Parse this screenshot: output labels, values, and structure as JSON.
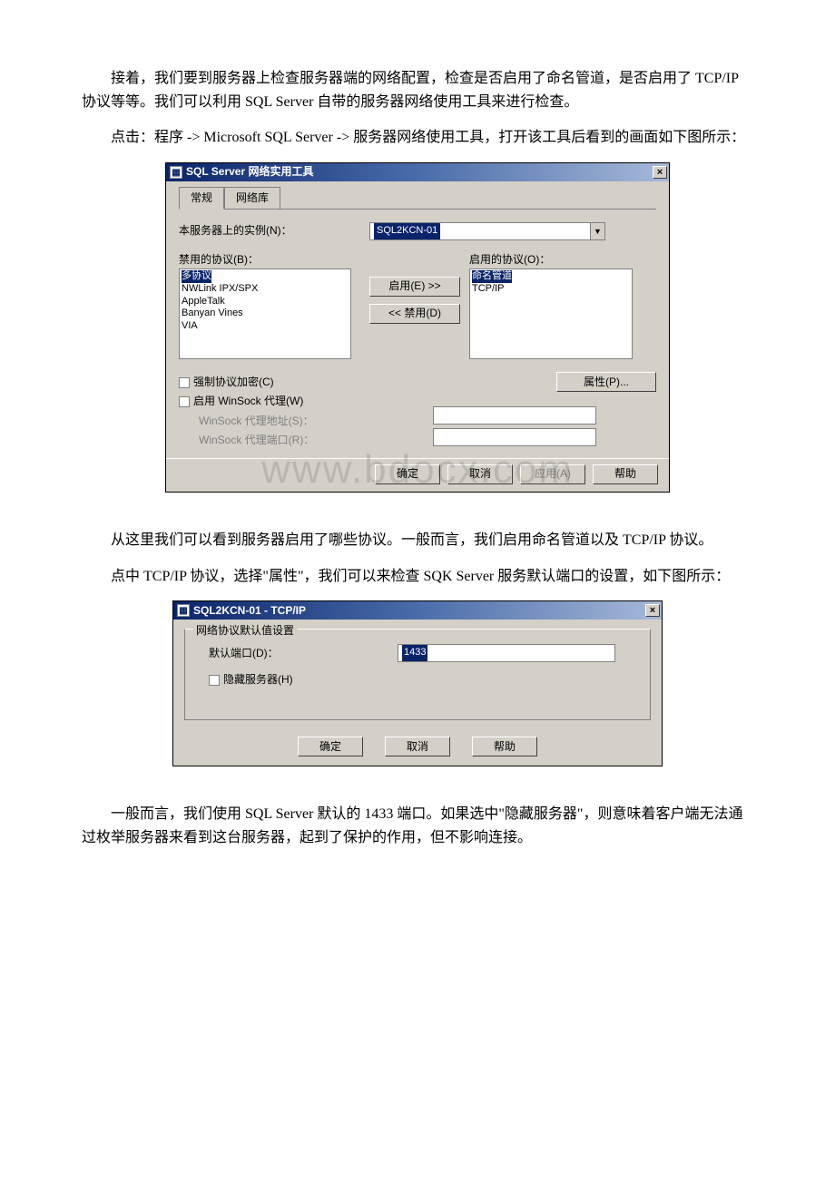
{
  "paragraphs": {
    "p1": "接着，我们要到服务器上检查服务器端的网络配置，检查是否启用了命名管道，是否启用了 TCP/IP 协议等等。我们可以利用 SQL Server 自带的服务器网络使用工具来进行检查。",
    "p2": "点击：程序 -> Microsoft SQL Server -> 服务器网络使用工具，打开该工具后看到的画面如下图所示：",
    "p3": "从这里我们可以看到服务器启用了哪些协议。一般而言，我们启用命名管道以及 TCP/IP 协议。",
    "p4": "点中 TCP/IP 协议，选择\"属性\"，我们可以来检查 SQK Server 服务默认端口的设置，如下图所示：",
    "p5": "一般而言，我们使用 SQL Server 默认的 1433 端口。如果选中\"隐藏服务器\"，则意味着客户端无法通过枚举服务器来看到这台服务器，起到了保护的作用，但不影响连接。"
  },
  "watermark": "www.bdocx.com",
  "dialog1": {
    "title": "SQL Server 网络实用工具",
    "tabs": {
      "t0": "常规",
      "t1": "网络库"
    },
    "instance_label": "本服务器上的实例(N)：",
    "instance_value": "SQL2KCN-01",
    "disabled_label": "禁用的协议(B)：",
    "enabled_label": "启用的协议(O)：",
    "disabled_list": {
      "i0": "多协议",
      "i1": "NWLink IPX/SPX",
      "i2": "AppleTalk",
      "i3": "Banyan Vines",
      "i4": "VIA"
    },
    "enabled_list": {
      "i0": "命名管道",
      "i1": "TCP/IP"
    },
    "btn_enable": "启用(E) >>",
    "btn_disable": "<< 禁用(D)",
    "btn_props": "属性(P)...",
    "chk_encrypt": "强制协议加密(C)",
    "chk_winsock": "启用 WinSock 代理(W)",
    "lbl_proxy_addr": "WinSock 代理地址(S)：",
    "lbl_proxy_port": "WinSock 代理端口(R)：",
    "btn_ok": "确定",
    "btn_cancel": "取消",
    "btn_apply": "应用(A)",
    "btn_help": "帮助"
  },
  "dialog2": {
    "title": "SQL2KCN-01 - TCP/IP",
    "group": "网络协议默认值设置",
    "port_label": "默认端口(D)：",
    "port_value": "1433",
    "hide_label": "隐藏服务器(H)",
    "btn_ok": "确定",
    "btn_cancel": "取消",
    "btn_help": "帮助"
  }
}
